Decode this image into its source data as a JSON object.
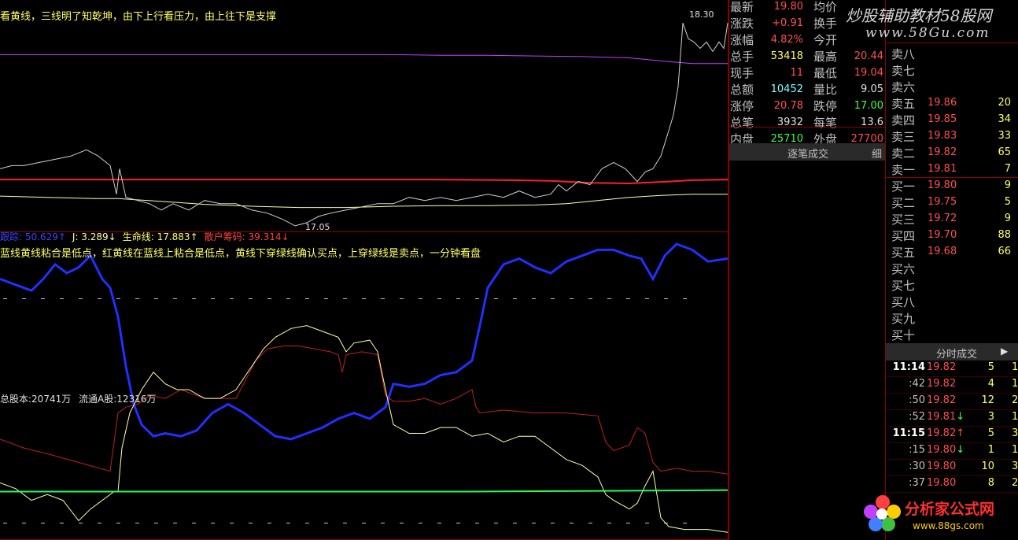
{
  "chart_data": [
    {
      "type": "line",
      "panel": "price",
      "title": "",
      "hint": "看黄线，三线明了知乾坤，由下上行看压力，由上往下是支撑",
      "labels": {
        "high": "18.30",
        "low": "17.05"
      },
      "series": [
        {
          "color": "#c040ff",
          "x": [
            0,
            50,
            100,
            150,
            200,
            260,
            320,
            380,
            440,
            500,
            560,
            620,
            680,
            740,
            800,
            850,
            880,
            925
          ],
          "y": [
            19.8,
            19.8,
            19.8,
            19.8,
            19.8,
            19.8,
            19.8,
            19.8,
            19.8,
            19.8,
            19.79,
            19.79,
            19.78,
            19.77,
            19.75,
            19.69,
            19.66,
            19.66
          ]
        },
        {
          "color": "#ff2020",
          "x": [
            0,
            150,
            250,
            350,
            450,
            550,
            650,
            700,
            750,
            800,
            850,
            880,
            925
          ],
          "y": [
            17.83,
            17.83,
            17.83,
            17.83,
            17.83,
            17.83,
            17.82,
            17.81,
            17.78,
            17.77,
            17.8,
            17.82,
            17.83
          ]
        },
        {
          "color": "#ffffaa",
          "x": [
            0,
            60,
            120,
            150,
            200,
            260,
            320,
            380,
            440,
            500,
            560,
            620,
            680,
            720,
            760,
            800,
            840,
            880,
            925
          ],
          "y": [
            17.57,
            17.55,
            17.53,
            17.53,
            17.49,
            17.44,
            17.41,
            17.39,
            17.39,
            17.41,
            17.42,
            17.42,
            17.43,
            17.45,
            17.5,
            17.55,
            17.58,
            17.6,
            17.6
          ]
        },
        {
          "color": "#d0d0d0",
          "x": [
            0,
            15,
            30,
            50,
            70,
            90,
            110,
            125,
            140,
            148,
            152,
            160,
            175,
            190,
            205,
            220,
            240,
            260,
            280,
            300,
            320,
            340,
            360,
            375,
            390,
            405,
            420,
            440,
            460,
            480,
            500,
            520,
            540,
            560,
            580,
            600,
            620,
            640,
            660,
            680,
            700,
            710,
            720,
            735,
            750,
            765,
            780,
            795,
            810,
            820,
            830,
            840,
            850,
            856,
            862,
            868,
            875,
            882,
            890,
            898,
            906,
            914,
            920,
            925
          ],
          "y": [
            18.0,
            18.05,
            18.05,
            18.1,
            18.15,
            18.2,
            18.3,
            18.2,
            18.05,
            17.6,
            18.0,
            17.55,
            17.5,
            17.45,
            17.35,
            17.45,
            17.35,
            17.5,
            17.45,
            17.45,
            17.35,
            17.3,
            17.2,
            17.1,
            17.15,
            17.25,
            17.3,
            17.35,
            17.4,
            17.45,
            17.45,
            17.55,
            17.5,
            17.55,
            17.5,
            17.55,
            17.6,
            17.55,
            17.65,
            17.55,
            17.6,
            17.75,
            17.65,
            17.8,
            17.75,
            18.0,
            18.1,
            18.0,
            17.8,
            17.95,
            18.0,
            18.2,
            18.6,
            18.85,
            19.3,
            20.3,
            20.05,
            20.0,
            19.9,
            20.0,
            19.85,
            20.0,
            19.9,
            20.3
          ]
        }
      ]
    },
    {
      "type": "line",
      "panel": "indicator",
      "title": "",
      "hint": "蓝线黄线粘合是低点，红黄线在蓝线上粘合是低点，黄线下穿绿线确认买点，上穿绿线是卖点，一分钟看盘",
      "legend": [
        {
          "name": "跟踪",
          "value": "50.629",
          "arrow": "↑",
          "color": "#4040ff"
        },
        {
          "name": "J",
          "value": "3.289",
          "arrow": "↓",
          "color": "#ffffaa"
        },
        {
          "name": "生命线",
          "value": "17.883",
          "arrow": "↑",
          "color": "#ffff66"
        },
        {
          "name": "散户筹码",
          "value": "39.314",
          "arrow": "↓",
          "color": "#ff4040"
        }
      ],
      "ylim": [
        0,
        100
      ],
      "series": [
        {
          "name": "跟踪",
          "color": "#2030ff",
          "x": [
            0,
            20,
            40,
            55,
            70,
            85,
            100,
            115,
            130,
            140,
            150,
            160,
            170,
            180,
            195,
            210,
            230,
            250,
            270,
            290,
            310,
            330,
            350,
            370,
            390,
            410,
            430,
            450,
            470,
            490,
            500,
            520,
            540,
            560,
            580,
            600,
            610,
            620,
            640,
            660,
            680,
            700,
            720,
            740,
            760,
            780,
            800,
            815,
            830,
            845,
            860,
            880,
            900,
            925
          ],
          "y": [
            88,
            86,
            84,
            88,
            93,
            90,
            92,
            96,
            88,
            85,
            75,
            58,
            45,
            38,
            34,
            35,
            34,
            36,
            42,
            45,
            42,
            38,
            34,
            33,
            35,
            37,
            40,
            42,
            40,
            44,
            52,
            51,
            52,
            55,
            56,
            60,
            72,
            85,
            93,
            95,
            92,
            90,
            94,
            96,
            98,
            98,
            96,
            95,
            88,
            96,
            100,
            98,
            94,
            95
          ]
        },
        {
          "name": "散户筹码",
          "color": "#c02020",
          "x": [
            0,
            30,
            60,
            100,
            140,
            150,
            160,
            175,
            190,
            210,
            230,
            260,
            300,
            325,
            340,
            360,
            380,
            400,
            420,
            430,
            435,
            440,
            460,
            480,
            490,
            500,
            520,
            540,
            560,
            580,
            600,
            605,
            610,
            640,
            680,
            720,
            760,
            770,
            780,
            800,
            810,
            820,
            830,
            840,
            860,
            880,
            900,
            925
          ],
          "y": [
            33,
            30,
            28,
            25,
            22,
            42,
            44,
            45,
            48,
            47,
            50,
            47,
            47,
            60,
            64,
            65,
            65,
            64,
            63,
            62,
            56,
            62,
            63,
            62,
            48,
            46,
            46,
            47,
            45,
            47,
            50,
            44,
            42,
            43,
            42,
            42,
            41,
            32,
            29,
            31,
            37,
            35,
            25,
            22,
            23,
            22,
            22,
            21
          ]
        },
        {
          "name": "J",
          "color": "#ffffaa",
          "x": [
            0,
            20,
            40,
            60,
            80,
            100,
            115,
            130,
            145,
            150,
            155,
            165,
            180,
            195,
            210,
            225,
            240,
            260,
            280,
            300,
            320,
            335,
            350,
            370,
            390,
            410,
            430,
            440,
            450,
            470,
            480,
            490,
            500,
            520,
            540,
            560,
            580,
            600,
            620,
            640,
            660,
            680,
            700,
            720,
            740,
            760,
            770,
            780,
            800,
            810,
            820,
            830,
            840,
            850,
            870,
            900,
            925
          ],
          "y": [
            18,
            16,
            12,
            14,
            12,
            5,
            9,
            12,
            15,
            15,
            30,
            42,
            50,
            56,
            52,
            50,
            50,
            47,
            47,
            50,
            58,
            64,
            68,
            71,
            72,
            70,
            68,
            63,
            66,
            67,
            63,
            50,
            38,
            35,
            35,
            37,
            37,
            34,
            35,
            32,
            34,
            34,
            30,
            26,
            24,
            20,
            14,
            12,
            9,
            11,
            17,
            22,
            6,
            3,
            2,
            2,
            1
          ]
        },
        {
          "name": "生命线",
          "color": "#20ff60",
          "x": [
            0,
            200,
            400,
            600,
            800,
            925
          ],
          "y": [
            15,
            15,
            15,
            15,
            15.3,
            15.5
          ]
        }
      ]
    }
  ],
  "share_info": {
    "total": "总股本:20741万",
    "float": "流通A股:12316万"
  },
  "quote": {
    "rows": [
      {
        "k1": "最新",
        "v1": "19.80",
        "c1": "#ff5050",
        "k2": "均价",
        "v2": "",
        "c2": "#ff5050"
      },
      {
        "k1": "涨跌",
        "v1": "+0.91",
        "c1": "#ff5050",
        "k2": "换手",
        "v2": "",
        "c2": "#c0c0c0"
      },
      {
        "k1": "涨幅",
        "v1": "4.82%",
        "c1": "#ff5050",
        "k2": "今开",
        "v2": "",
        "c2": "#c0c0c0"
      },
      {
        "k1": "总手",
        "v1": "53418",
        "c1": "#ffff66",
        "k2": "最高",
        "v2": "20.44",
        "c2": "#ff5050"
      },
      {
        "k1": "现手",
        "v1": "11",
        "c1": "#ff5050",
        "k2": "最低",
        "v2": "19.04",
        "c2": "#ff5050"
      },
      {
        "k1": "总额",
        "v1": "10452",
        "c1": "#80ffff",
        "k2": "量比",
        "v2": "9.05",
        "c2": "#e0e0e0"
      },
      {
        "k1": "涨停",
        "v1": "20.78",
        "c1": "#ff5050",
        "k2": "跌停",
        "v2": "17.00",
        "c2": "#40ff40"
      },
      {
        "k1": "总笔",
        "v1": "3932",
        "c1": "#e0e0e0",
        "k2": "每笔",
        "v2": "13.6",
        "c2": "#e0e0e0"
      },
      {
        "k1": "内盘",
        "v1": "25710",
        "c1": "#40ff40",
        "k2": "外盘",
        "v2": "27700",
        "c2": "#ff5050"
      }
    ],
    "stream_title": "逐笔成交",
    "stream_more": "细"
  },
  "book": {
    "asks": [
      {
        "label": "卖八",
        "price": "",
        "vol": ""
      },
      {
        "label": "卖七",
        "price": "",
        "vol": ""
      },
      {
        "label": "卖六",
        "price": "",
        "vol": ""
      },
      {
        "label": "卖五",
        "price": "19.86",
        "vol": "20"
      },
      {
        "label": "卖四",
        "price": "19.85",
        "vol": "34"
      },
      {
        "label": "卖三",
        "price": "19.83",
        "vol": "33"
      },
      {
        "label": "卖二",
        "price": "19.82",
        "vol": "65"
      },
      {
        "label": "卖一",
        "price": "19.81",
        "vol": "7"
      }
    ],
    "bids": [
      {
        "label": "买一",
        "price": "19.80",
        "vol": "9"
      },
      {
        "label": "买二",
        "price": "19.75",
        "vol": "5"
      },
      {
        "label": "买三",
        "price": "19.72",
        "vol": "9"
      },
      {
        "label": "买四",
        "price": "19.70",
        "vol": "88"
      },
      {
        "label": "买五",
        "price": "19.68",
        "vol": "66"
      },
      {
        "label": "买六",
        "price": "",
        "vol": ""
      },
      {
        "label": "买七",
        "price": "",
        "vol": ""
      },
      {
        "label": "买八",
        "price": "",
        "vol": ""
      },
      {
        "label": "买九",
        "price": "",
        "vol": ""
      },
      {
        "label": "买十",
        "price": "",
        "vol": ""
      }
    ]
  },
  "ticks": {
    "title": "分时成交",
    "rows": [
      {
        "time": "11:14",
        "full": true,
        "price": "19.82",
        "arrow": "",
        "vol": "5",
        "extra": "1"
      },
      {
        "time": ":42",
        "full": false,
        "price": "19.82",
        "arrow": "",
        "vol": "4",
        "extra": "1"
      },
      {
        "time": ":50",
        "full": false,
        "price": "19.82",
        "arrow": "",
        "vol": "12",
        "extra": "2"
      },
      {
        "time": ":52",
        "full": false,
        "price": "19.81",
        "arrow": "↓",
        "vol": "3",
        "extra": "1"
      },
      {
        "time": "11:15",
        "full": true,
        "price": "19.82",
        "arrow": "↑",
        "vol": "5",
        "extra": "3"
      },
      {
        "time": ":15",
        "full": false,
        "price": "19.80",
        "arrow": "↓",
        "vol": "1",
        "extra": "1"
      },
      {
        "time": ":30",
        "full": false,
        "price": "19.80",
        "arrow": "",
        "vol": "10",
        "extra": "3"
      },
      {
        "time": ":37",
        "full": false,
        "price": "19.80",
        "arrow": "",
        "vol": "8",
        "extra": "2"
      }
    ]
  },
  "watermarks": {
    "top": "炒股辅助教材58股网",
    "top_url": "www.58Gu.com",
    "bottom": "分析家公式网",
    "bottom_url": "www.88gs.com"
  }
}
